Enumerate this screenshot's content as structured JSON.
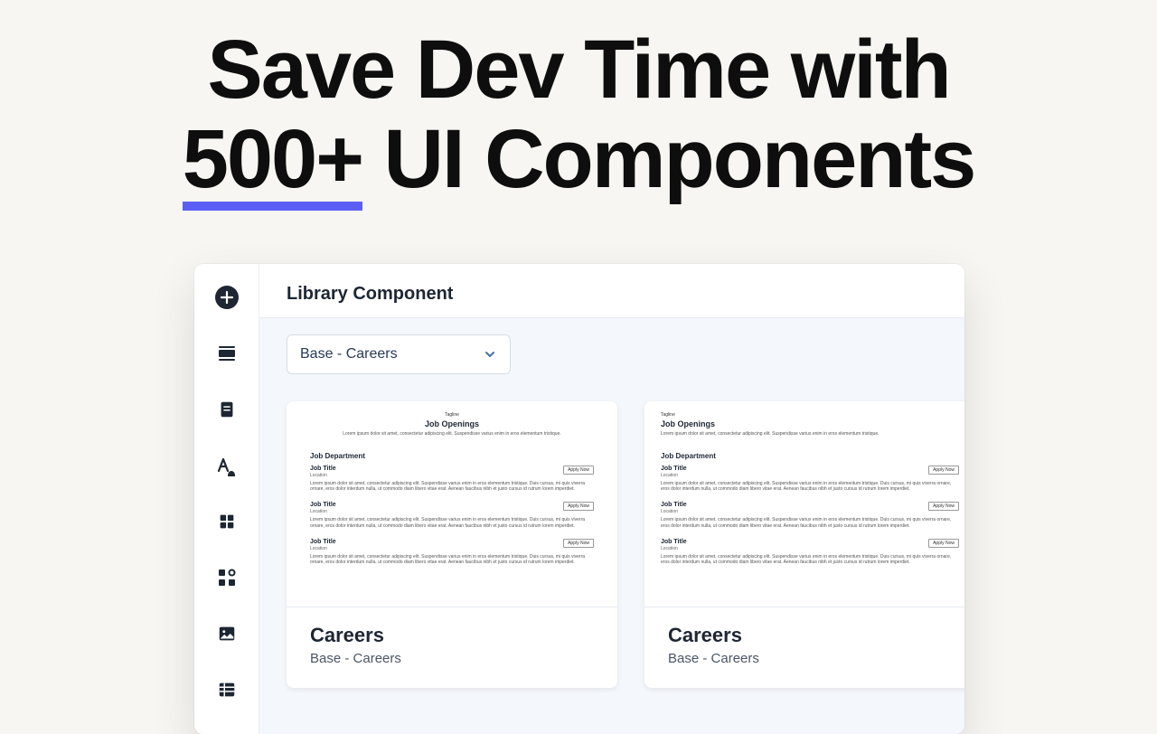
{
  "hero": {
    "line1_prefix": "Save Dev Time with",
    "highlight": "500+",
    "line2_rest": " UI Components"
  },
  "sidebar": {
    "items": [
      "add",
      "sections",
      "page",
      "typography",
      "grid",
      "components",
      "image",
      "data-table"
    ]
  },
  "panel": {
    "title": "Library Component",
    "dropdown_selected": "Base - Careers"
  },
  "preview": {
    "tagline": "Tagline",
    "heading": "Job Openings",
    "subtext": "Lorem ipsum dolor sit amet, consectetur adipiscing elit. Suspendisse varius enim in eros elementum tristique.",
    "department": "Job Department",
    "job_title": "Job Title",
    "job_location": "Location",
    "apply_label": "Apply Now",
    "job_desc": "Lorem ipsum dolor sit amet, consectetur adipiscing elit. Suspendisse varius enim in eros elementum tristique. Duis cursus, mi quis viverra ornare, eros dolor interdum nulla, ut commodo diam libero vitae erat. Aenean faucibus nibh et justo cursus id rutrum lorem imperdiet."
  },
  "cards": [
    {
      "title": "Careers",
      "subtitle": "Base - Careers",
      "layout": "center"
    },
    {
      "title": "Careers",
      "subtitle": "Base - Careers",
      "layout": "left"
    }
  ]
}
